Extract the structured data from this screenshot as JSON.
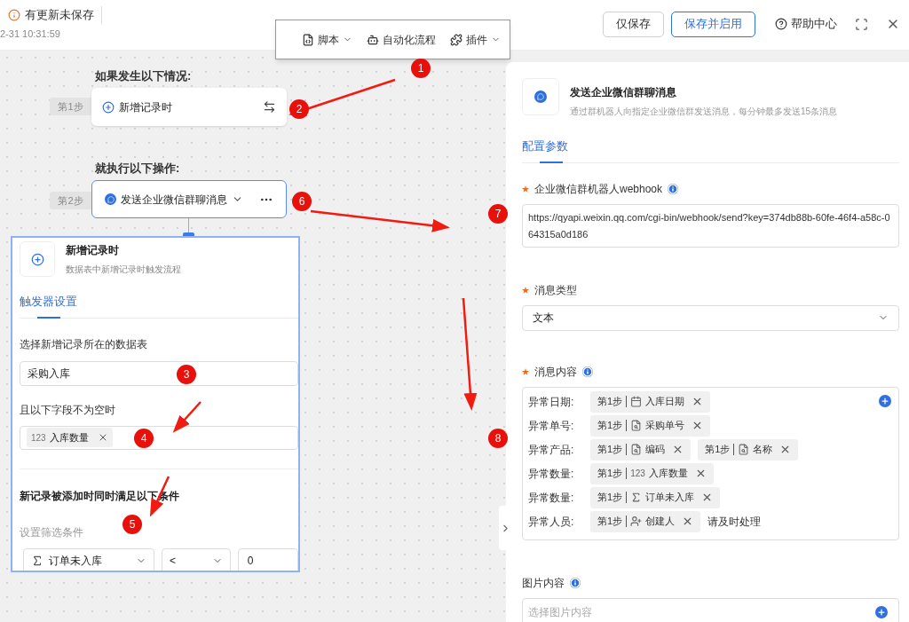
{
  "header": {
    "status": "有更新未保存",
    "timestamp": "2-31 10:31:59",
    "buttons": [
      {
        "label": "仅保存",
        "kind": "plain"
      },
      {
        "label": "保存并启用",
        "kind": "primary"
      }
    ],
    "help": "帮助中心"
  },
  "toolbar": [
    {
      "label": "脚本",
      "kind": "script",
      "dropdown": true
    },
    {
      "label": "自动化流程",
      "kind": "bot",
      "dropdown": false
    },
    {
      "label": "插件",
      "kind": "plugin",
      "dropdown": true
    }
  ],
  "canvas": {
    "trigger_heading": "如果发生以下情况:",
    "trigger_step": "第1步",
    "trigger_node": "新增记录时",
    "action_heading": "就执行以下操作:",
    "action_step": "第2步",
    "action_node": "发送企业微信群聊消息"
  },
  "trigger_panel": {
    "title": "新增记录时",
    "description": "数据表中新增记录时触发流程",
    "tabs": [
      {
        "label": "触发器设置",
        "selected": true
      }
    ],
    "table_label": "选择新增记录所在的数据表",
    "table_value": "采购入库",
    "fields_label": "且以下字段不为空时",
    "field_tags": [
      {
        "prefix": "123",
        "text": "入库数量"
      }
    ],
    "condition_heading": "新记录被添加时同时满足以下条件",
    "condition_hint": "设置筛选条件",
    "condition": {
      "field": "订单未入库",
      "operator": "<",
      "value": "0"
    }
  },
  "action_panel": {
    "title": "发送企业微信群聊消息",
    "description": "通过群机器人向指定企业微信群发送消息，每分钟最多发送15条消息",
    "tabs": [
      {
        "label": "配置参数",
        "selected": true
      }
    ],
    "webhook": {
      "label": "企业微信群机器人webhook",
      "required": true,
      "value": "https://qyapi.weixin.qq.com/cgi-bin/webhook/send?key=374db88b-60fe-46f4-a58c-064315a0d186"
    },
    "message_type": {
      "label": "消息类型",
      "required": true,
      "value": "文本"
    },
    "message_content": {
      "label": "消息内容",
      "required": true,
      "rows": [
        {
          "label": "异常日期:",
          "tokens": [
            {
              "step": "第1步",
              "kind": "date",
              "field": "入库日期"
            }
          ]
        },
        {
          "label": "异常单号:",
          "tokens": [
            {
              "step": "第1步",
              "kind": "lookup",
              "field": "采购单号"
            }
          ]
        },
        {
          "label": "异常产品:",
          "tokens": [
            {
              "step": "第1步",
              "kind": "lookup",
              "field": "编码"
            },
            {
              "step": "第1步",
              "kind": "lookup",
              "field": "名称"
            }
          ]
        },
        {
          "label": "异常数量:",
          "tokens": [
            {
              "step": "第1步",
              "kind": "number",
              "prefix": "123",
              "field": "入库数量"
            }
          ]
        },
        {
          "label": "异常数量:",
          "tokens": [
            {
              "step": "第1步",
              "kind": "formula",
              "field": "订单未入库"
            }
          ]
        },
        {
          "label": "异常人员:",
          "tokens": [
            {
              "step": "第1步",
              "kind": "user",
              "field": "创建人"
            }
          ],
          "trailing": "请及时处理"
        }
      ]
    },
    "image_content": {
      "label": "图片内容",
      "required": false,
      "placeholder": "选择图片内容"
    }
  },
  "annotations": [
    {
      "label": "1"
    },
    {
      "label": "2"
    },
    {
      "label": "3"
    },
    {
      "label": "4"
    },
    {
      "label": "5"
    },
    {
      "label": "6"
    },
    {
      "label": "7"
    },
    {
      "label": "8"
    }
  ]
}
